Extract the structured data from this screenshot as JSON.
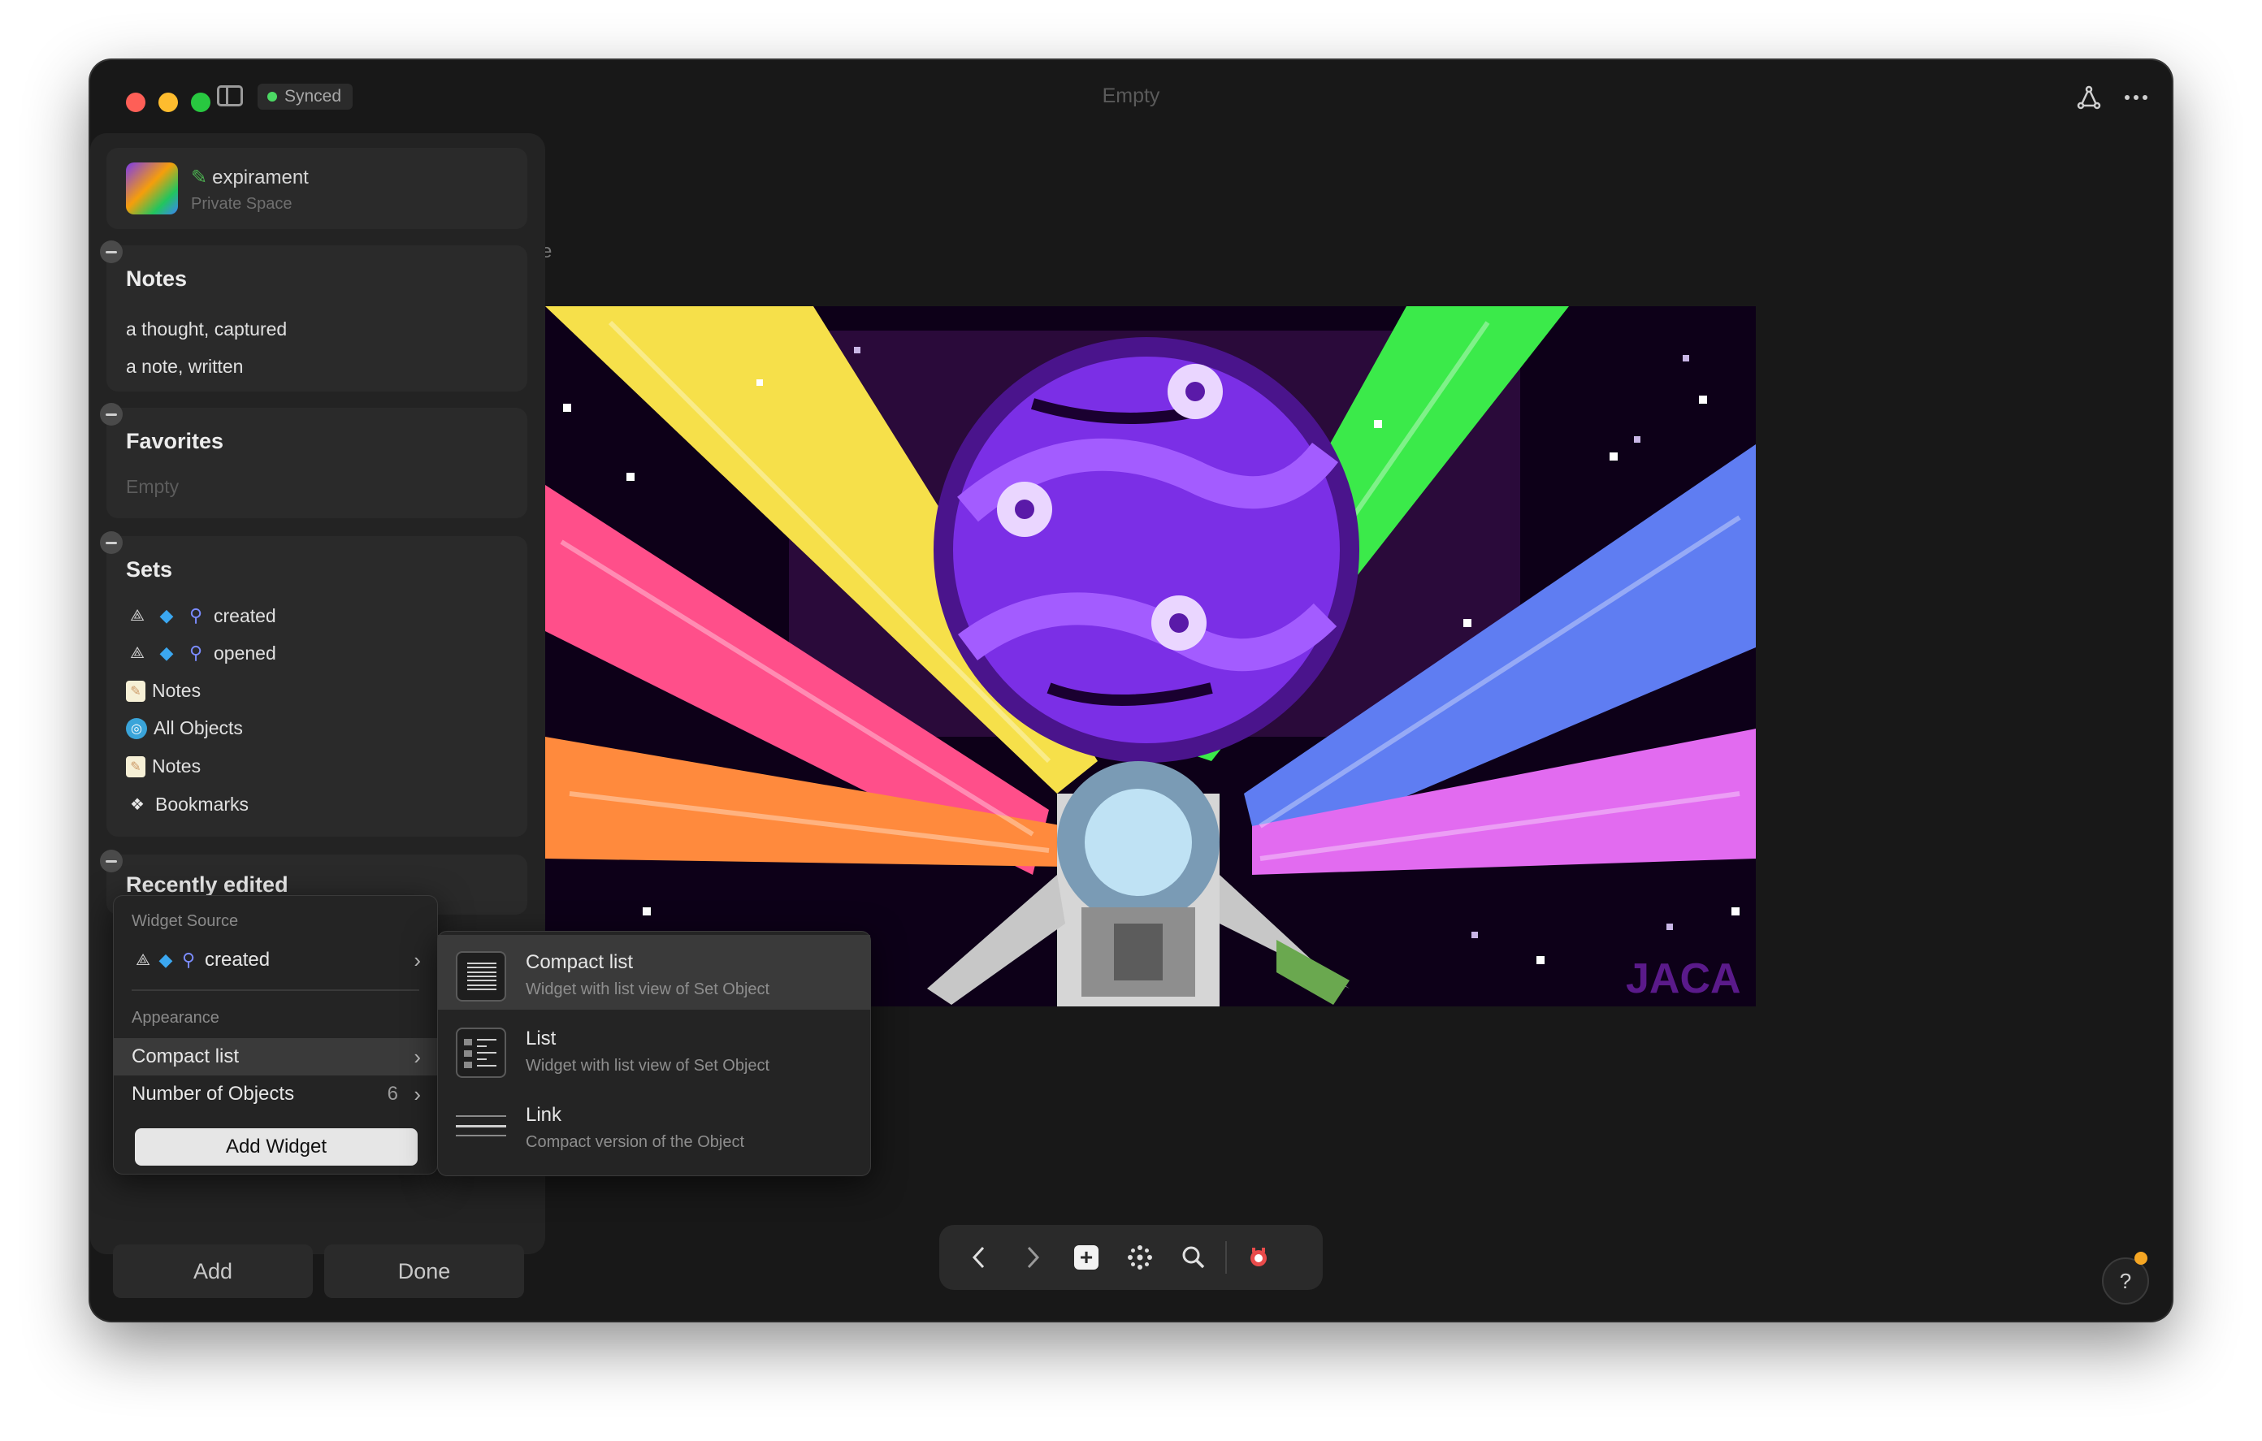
{
  "window": {
    "title": "Empty",
    "sync_status": "Synced"
  },
  "space": {
    "name": "expirament",
    "type": "Private Space"
  },
  "widgets": {
    "notes": {
      "title": "Notes",
      "items": [
        "a thought, captured",
        "a note, written"
      ]
    },
    "favorites": {
      "title": "Favorites",
      "empty_text": "Empty"
    },
    "sets": {
      "title": "Sets",
      "items": [
        "created",
        "opened",
        "Notes",
        "All Objects",
        "Notes",
        "Bookmarks"
      ]
    },
    "recent": {
      "title": "Recently edited"
    }
  },
  "popup": {
    "source_label": "Widget Source",
    "source_value": "created",
    "appearance_label": "Appearance",
    "appearance_value": "Compact list",
    "objects_label": "Number of Objects",
    "objects_count": "6",
    "add_widget_label": "Add Widget"
  },
  "submenu": [
    {
      "title": "Compact list",
      "desc": "Widget with list view of Set Object"
    },
    {
      "title": "List",
      "desc": "Widget with list view of Set Object"
    },
    {
      "title": "Link",
      "desc": "Compact version of the Object"
    }
  ],
  "sidebar_buttons": {
    "add": "Add",
    "done": "Done"
  },
  "cover": {
    "signature": "JACA"
  },
  "help_label": "?",
  "partial_text": "e",
  "colors": {
    "accent_synced": "#4cd964",
    "help_badge": "#f5a623"
  }
}
